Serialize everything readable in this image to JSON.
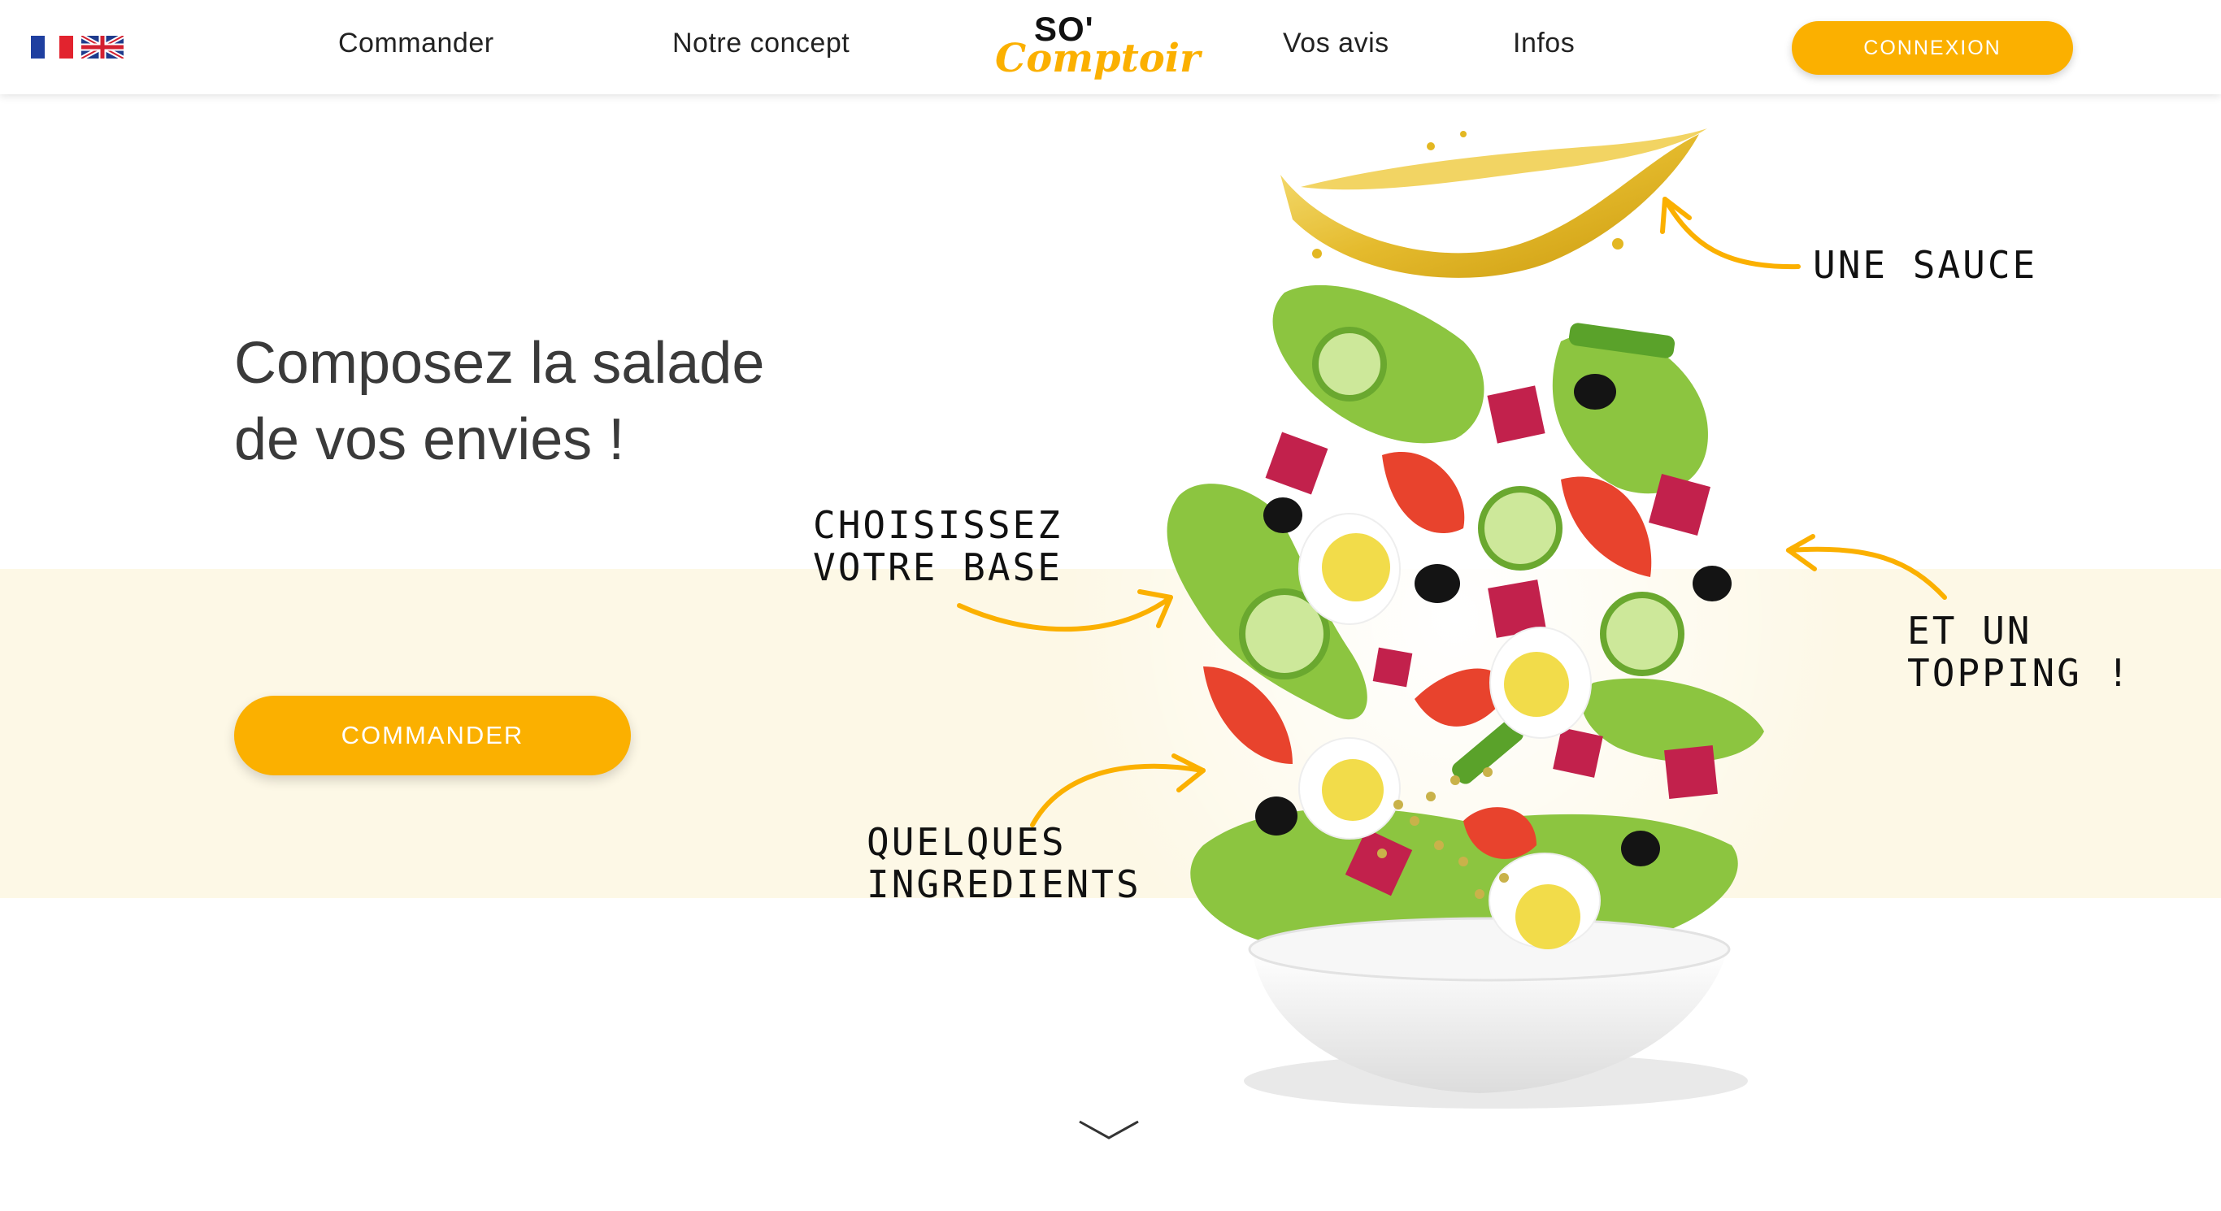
{
  "header": {
    "languages": [
      {
        "code": "FR",
        "icon": "france-flag-icon"
      },
      {
        "code": "EN",
        "icon": "uk-flag-icon"
      }
    ],
    "nav": {
      "commander": "Commander",
      "concept": "Notre concept",
      "avis": "Vos avis",
      "infos": "Infos"
    },
    "logo": {
      "top": "SO'",
      "script": "Comptoir"
    },
    "connexion_label": "CONNEXION"
  },
  "hero": {
    "title_line1": "Composez la salade",
    "title_line2": "de vos envies !",
    "cta_label": "COMMANDER",
    "annotations": {
      "sauce": "UNE SAUCE",
      "base": "CHOISISSEZ\nVOTRE BASE",
      "topping": "ET UN\nTOPPING !",
      "ingredients": "QUELQUES\nINGREDIENTS"
    },
    "scroll_icon": "chevron-down-icon"
  },
  "colors": {
    "accent": "#fbb000",
    "band": "#fdf8e6",
    "text": "#3a3a3a"
  }
}
